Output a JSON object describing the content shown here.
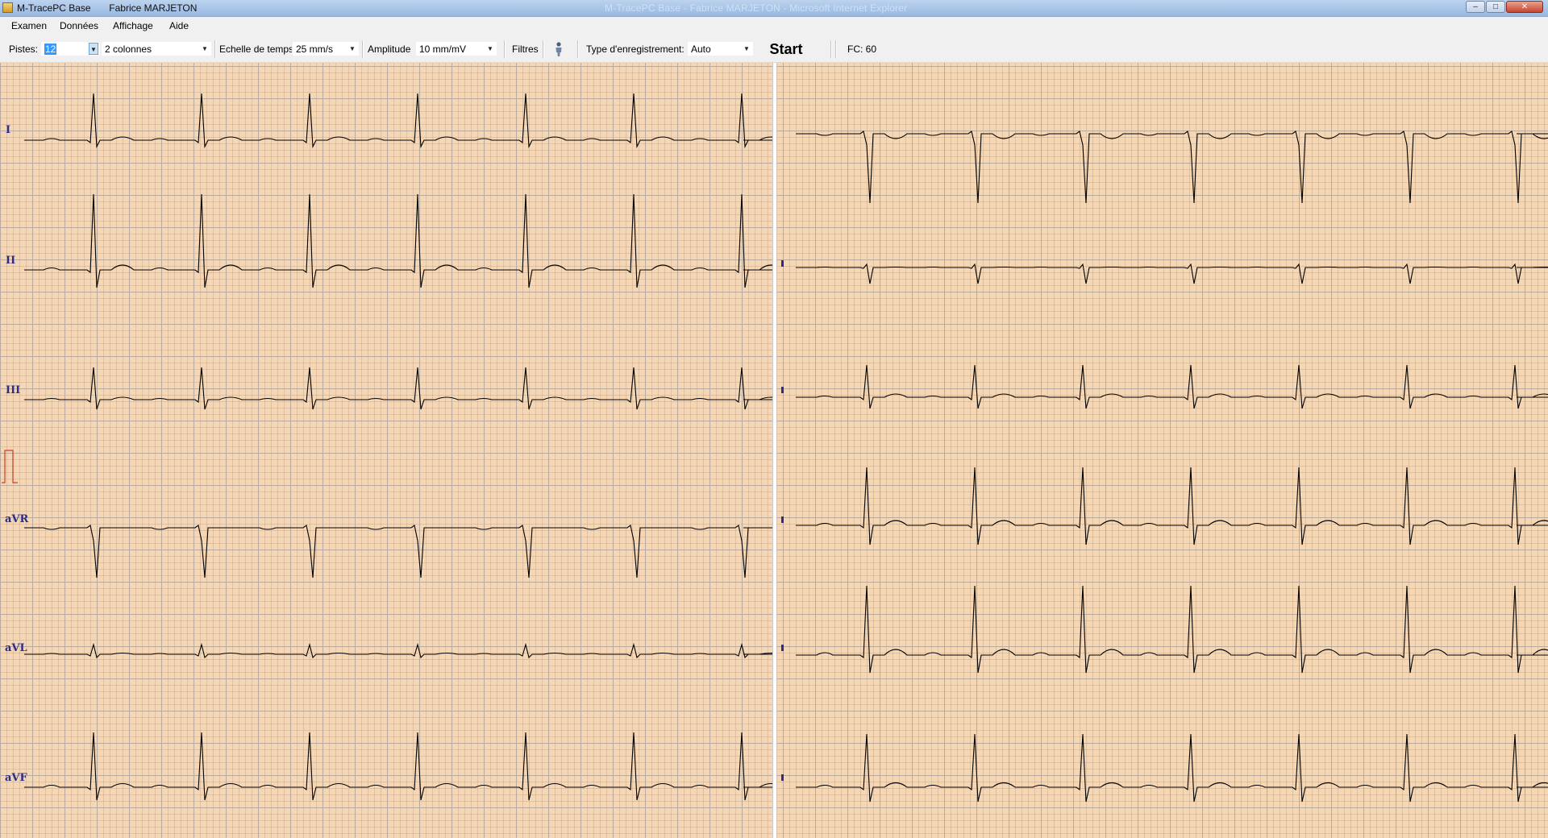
{
  "window": {
    "app_name": "M-TracePC Base",
    "user": "Fabrice  MARJETON",
    "faded_title": "M-TracePC Base - Fabrice MARJETON - Microsoft Internet Explorer",
    "controls": {
      "minimize": "–",
      "maximize": "□",
      "close": "✕"
    }
  },
  "menu": {
    "items": [
      "Examen",
      "Données",
      "Affichage",
      "Aide"
    ]
  },
  "toolbar": {
    "pistes_label": "Pistes:",
    "pistes_value": "12",
    "colonnes_value": "2 colonnes",
    "echelle_label": "Echelle de temps",
    "echelle_value": "25 mm/s",
    "amplitude_label": "Amplitude",
    "amplitude_value": "10 mm/mV",
    "filtres_label": "Filtres",
    "type_label": "Type d'enregistrement:",
    "type_value": "Auto",
    "start_label": "Start",
    "fc_label": "FC: 60",
    "person_icon": "person-icon"
  },
  "ecg": {
    "paper_color": "#f6d7b3",
    "grid_color": "#b9aaa0",
    "trace_color": "#000000",
    "calibration_color": "#d23b2b",
    "left_leads": [
      "I",
      "II",
      "III",
      "aVR",
      "aVL",
      "aVF"
    ],
    "right_leads": [
      "",
      "",
      "",
      "",
      "",
      ""
    ],
    "heart_rate_bpm": 60
  }
}
